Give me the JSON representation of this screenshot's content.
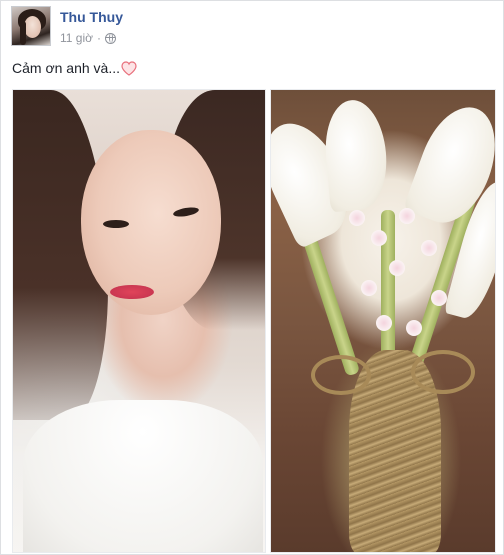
{
  "post": {
    "author": "Thu Thuy",
    "time": "11 giờ",
    "message": "Cảm ơn anh và...",
    "message_emoji": "heart-icon",
    "colors": {
      "author": "#365899",
      "meta": "#90949c",
      "text": "#1d2129",
      "heart_fill": "#fde4e6",
      "heart_stroke": "#e8707c"
    }
  }
}
